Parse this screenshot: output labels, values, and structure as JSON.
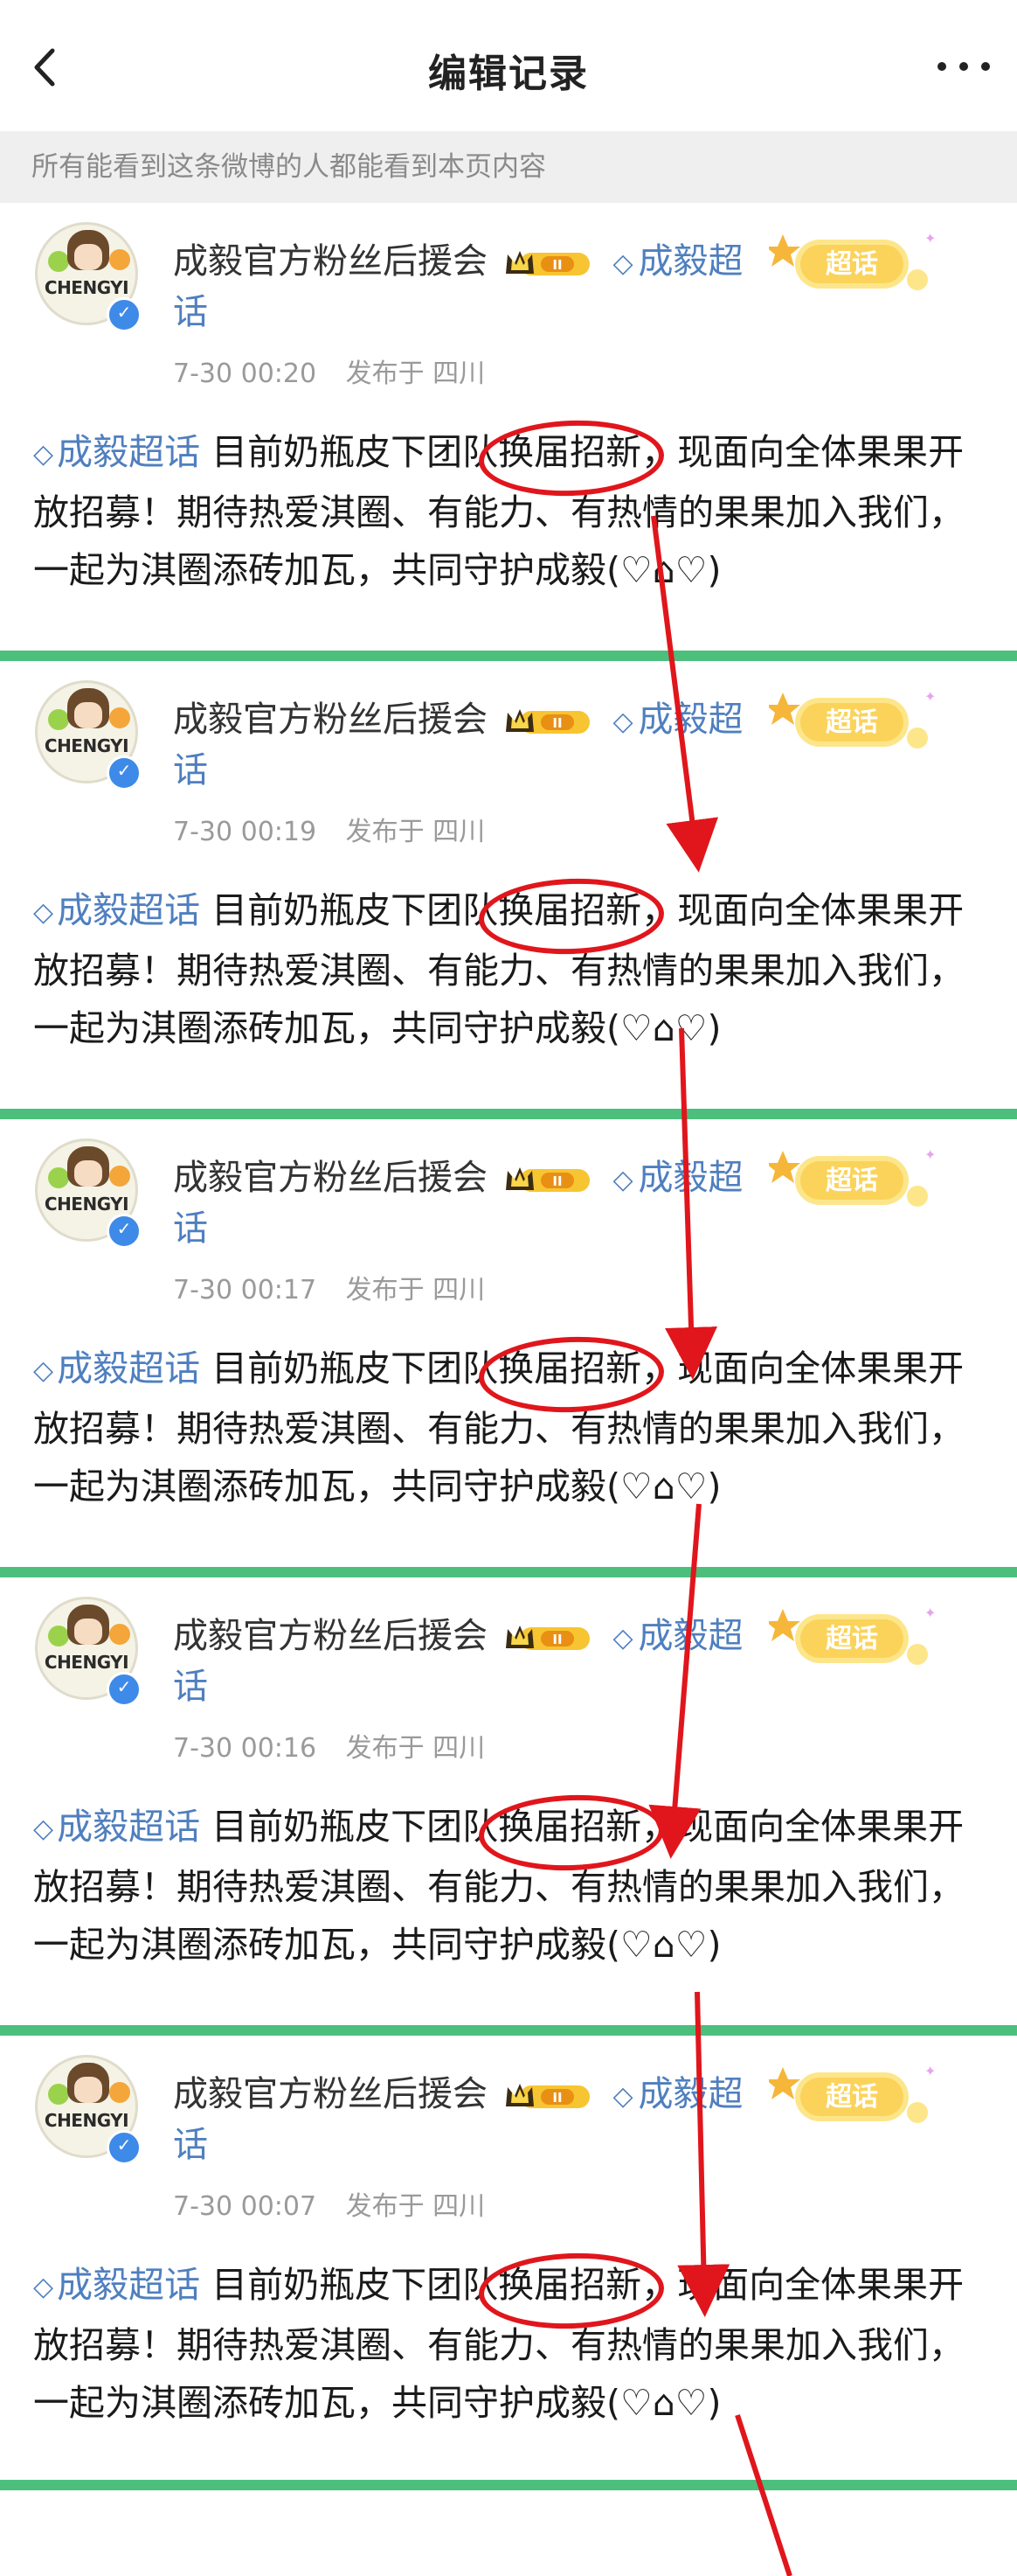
{
  "header": {
    "title": "编辑记录",
    "back_icon": "chevron-left-icon",
    "more_icon": "more-horizontal-icon"
  },
  "notice": "所有能看到这条微博的人都能看到本页内容",
  "account": {
    "name": "成毅官方粉丝后援会",
    "super_topic": "成毅超",
    "super_topic_wrap": "话",
    "badge_label": "超话",
    "avatar_text": "CHENGYI"
  },
  "post": {
    "tag": "成毅超话",
    "before_highlight": " 目前奶瓶皮下团队",
    "highlight": "换届招新",
    "after_highlight": "，现面向全体果果开放招募！期待热爱淇圈、有能力、有热情的果果加入我们，一起为淇圈添砖加瓦，共同守护成毅(♡⌂♡)"
  },
  "entries": [
    {
      "time": "7-30 00:20",
      "location": "发布于 四川"
    },
    {
      "time": "7-30 00:19",
      "location": "发布于 四川"
    },
    {
      "time": "7-30 00:17",
      "location": "发布于 四川"
    },
    {
      "time": "7-30 00:16",
      "location": "发布于 四川"
    },
    {
      "time": "7-30 00:07",
      "location": "发布于 四川"
    }
  ],
  "colors": {
    "separator": "#4cbf7c",
    "link": "#4f7fbf",
    "annotation": "#e0161c"
  }
}
